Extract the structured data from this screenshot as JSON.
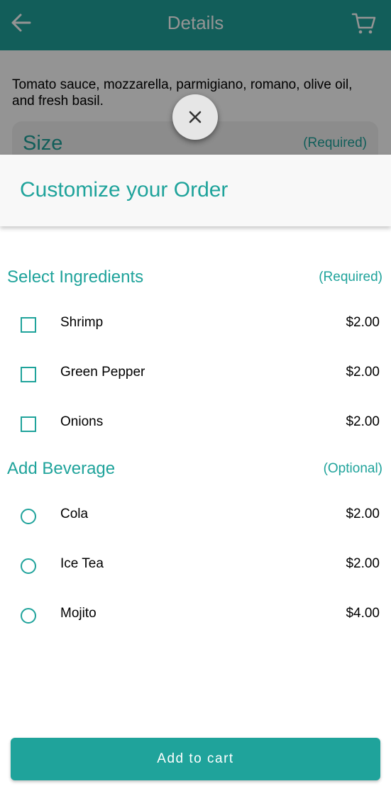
{
  "colors": {
    "accent": "#1fa39b",
    "header_bg": "#f8f8f8",
    "overlay": "rgba(0,0,0,0.42)"
  },
  "background": {
    "appbar": {
      "title": "Details",
      "back_icon": "arrow-left-icon",
      "cart_icon": "cart-icon"
    },
    "description": "Tomato sauce, mozzarella, parmigiano, romano, olive oil, and fresh basil.",
    "size_section": {
      "label": "Size",
      "note": "(Required)"
    }
  },
  "sheet": {
    "close_icon": "close-icon",
    "title": "Customize your Order",
    "ingredients": {
      "title": "Select Ingredients",
      "note": "(Required)",
      "items": [
        {
          "name": "Shrimp",
          "price": "$2.00",
          "checked": false
        },
        {
          "name": "Green Pepper",
          "price": "$2.00",
          "checked": false
        },
        {
          "name": "Onions",
          "price": "$2.00",
          "checked": false
        }
      ]
    },
    "beverages": {
      "title": "Add Beverage",
      "note": "(Optional)",
      "items": [
        {
          "name": "Cola",
          "price": "$2.00",
          "selected": false
        },
        {
          "name": "Ice Tea",
          "price": "$2.00",
          "selected": false
        },
        {
          "name": "Mojito",
          "price": "$4.00",
          "selected": false
        }
      ]
    },
    "add_to_cart_label": "Add to cart"
  }
}
